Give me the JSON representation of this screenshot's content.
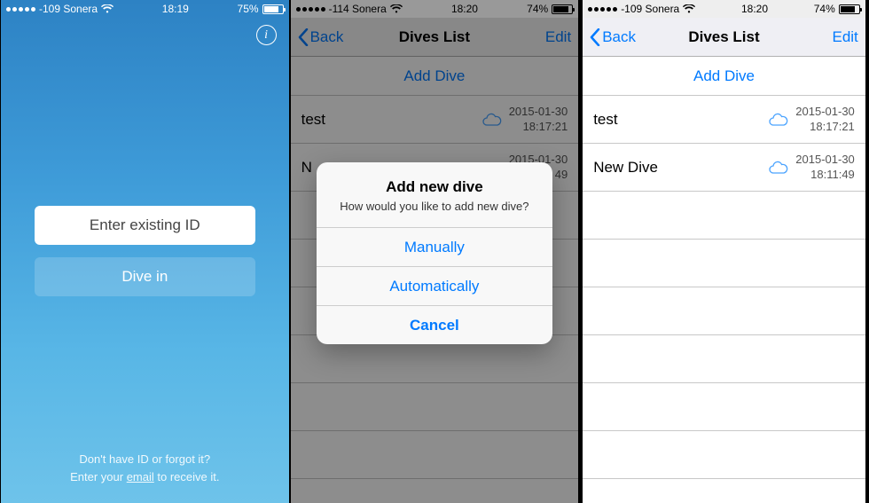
{
  "screen1": {
    "status": {
      "signal": "-109 Sonera",
      "time": "18:19",
      "battery": "75%"
    },
    "enter_label": "Enter existing ID",
    "divein_label": "Dive in",
    "foot_line1": "Don't have ID or forgot it?",
    "foot_prefix": "Enter your ",
    "foot_link": "email",
    "foot_suffix": " to receive it."
  },
  "screen2": {
    "status": {
      "signal": "-114 Sonera",
      "time": "18:20",
      "battery": "74%"
    },
    "nav": {
      "back": "Back",
      "title": "Dives List",
      "edit": "Edit"
    },
    "add_label": "Add Dive",
    "rows": [
      {
        "name": "test",
        "date": "2015-01-30",
        "time": "18:17:21"
      },
      {
        "name": "N",
        "date": "2015-01-30",
        "time": "49"
      }
    ],
    "alert": {
      "title": "Add new dive",
      "message": "How would you like to add new dive?",
      "opt_manual": "Manually",
      "opt_auto": "Automatically",
      "cancel": "Cancel"
    }
  },
  "screen3": {
    "status": {
      "signal": "-109 Sonera",
      "time": "18:20",
      "battery": "74%"
    },
    "nav": {
      "back": "Back",
      "title": "Dives List",
      "edit": "Edit"
    },
    "add_label": "Add Dive",
    "rows": [
      {
        "name": "test",
        "date": "2015-01-30",
        "time": "18:17:21"
      },
      {
        "name": "New Dive",
        "date": "2015-01-30",
        "time": "18:11:49"
      }
    ]
  }
}
